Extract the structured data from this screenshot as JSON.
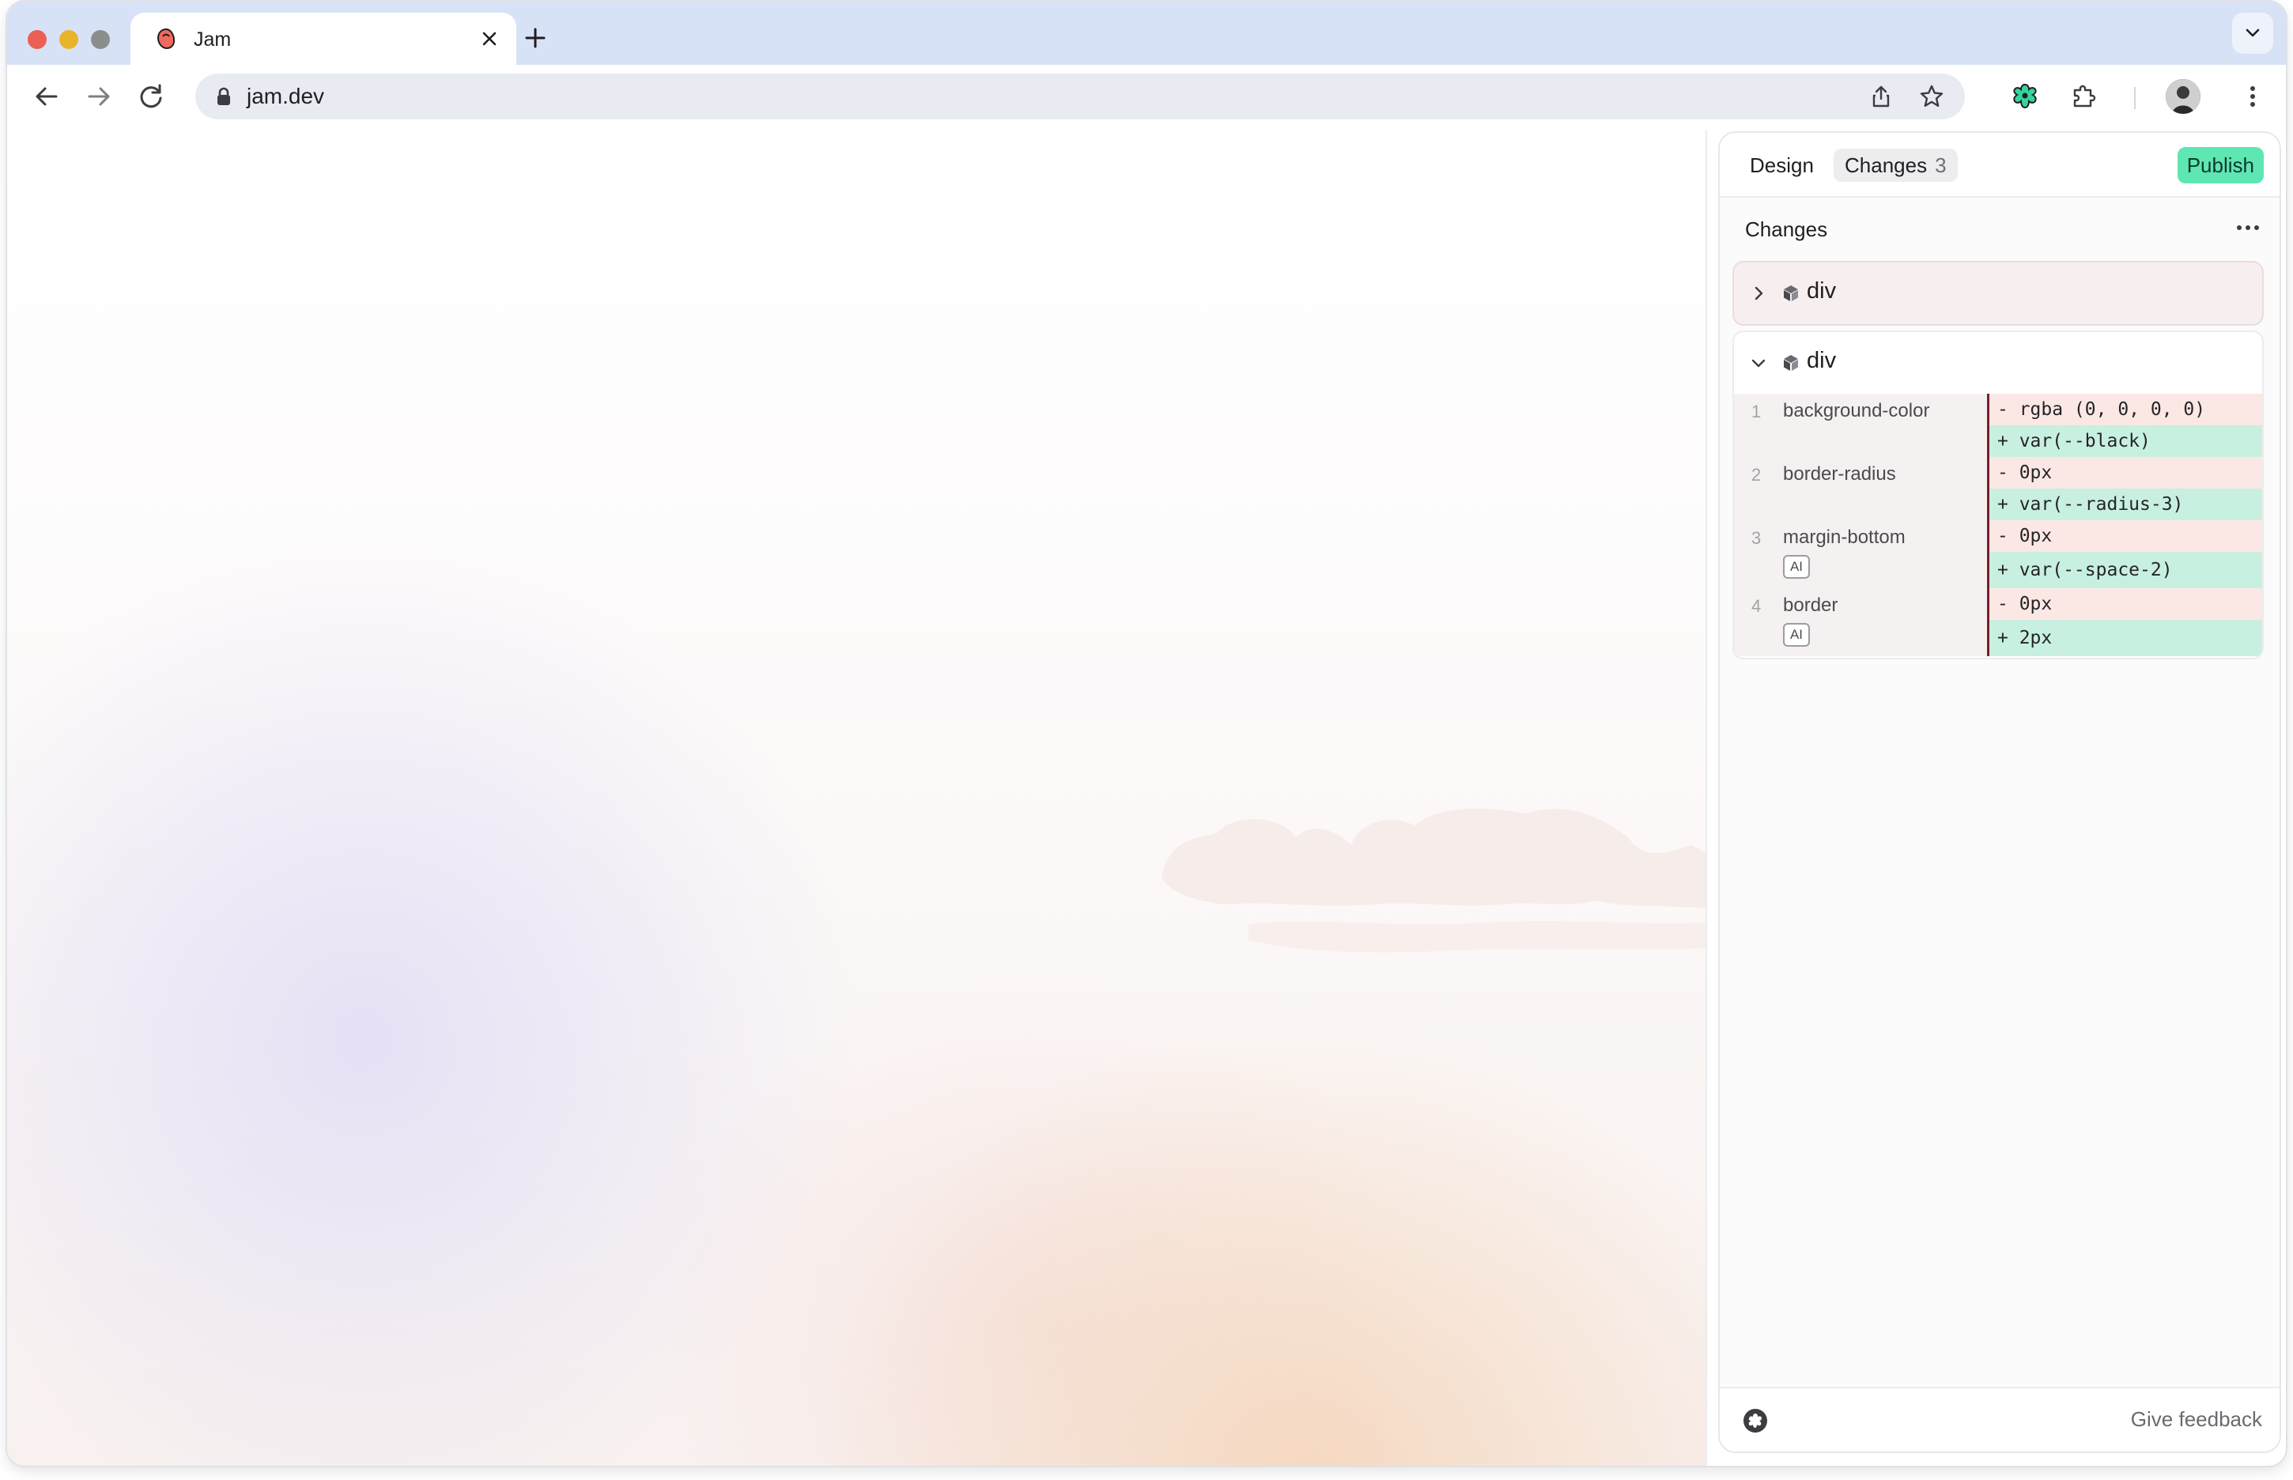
{
  "browser": {
    "tab": {
      "title": "Jam",
      "favicon": "jam-logo-icon"
    },
    "url": "jam.dev"
  },
  "panel": {
    "tabs": [
      {
        "label": "Design"
      },
      {
        "label": "Changes",
        "count": "3"
      }
    ],
    "publish_label": "Publish",
    "section_title": "Changes",
    "groups": [
      {
        "name": "div",
        "expanded": false
      },
      {
        "name": "div",
        "expanded": true,
        "changes": [
          {
            "num": "1",
            "property": "background-color",
            "ai": false,
            "removed": "- rgba (0, 0, 0, 0)",
            "added": "+ var(--black)"
          },
          {
            "num": "2",
            "property": "border-radius",
            "ai": false,
            "removed": "- 0px",
            "added": "+ var(--radius-3)"
          },
          {
            "num": "3",
            "property": "margin-bottom",
            "ai": true,
            "ai_label": "AI",
            "removed": "- 0px",
            "added": "+ var(--space-2)"
          },
          {
            "num": "4",
            "property": "border",
            "ai": true,
            "ai_label": "AI",
            "removed": "- 0px",
            "added": "+ 2px"
          }
        ]
      }
    ],
    "footer": {
      "feedback_label": "Give feedback"
    }
  },
  "colors": {
    "publish": "#5ee6b3",
    "removed_bg": "#fbe8e4",
    "added_bg": "#c7f0e0",
    "tabstrip": "#d8e2f7"
  }
}
